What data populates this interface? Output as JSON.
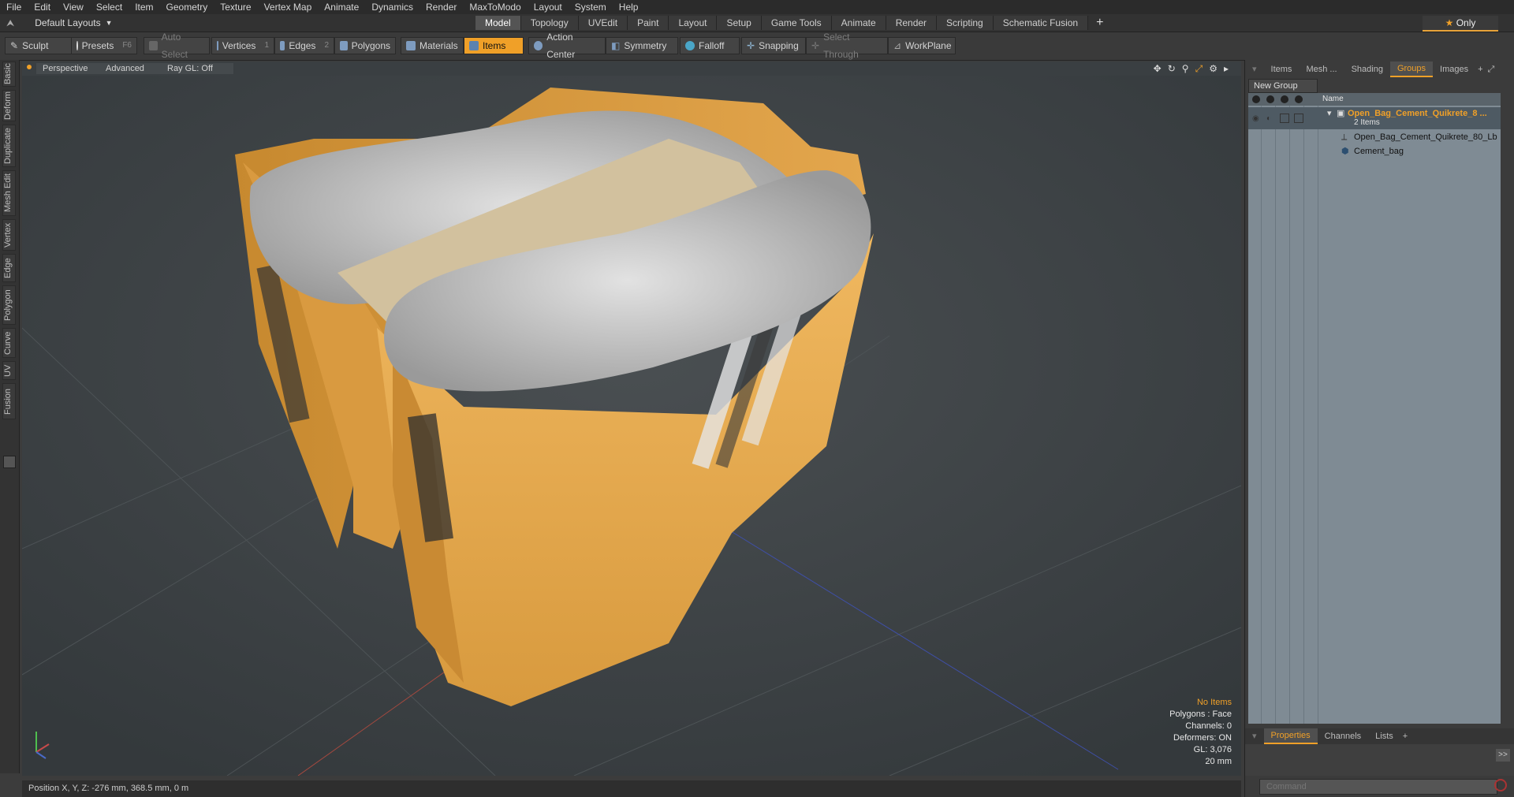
{
  "menu": [
    "File",
    "Edit",
    "View",
    "Select",
    "Item",
    "Geometry",
    "Texture",
    "Vertex Map",
    "Animate",
    "Dynamics",
    "Render",
    "MaxToModo",
    "Layout",
    "System",
    "Help"
  ],
  "layout": {
    "dropdown": "Default Layouts",
    "tabs": [
      "Model",
      "Topology",
      "UVEdit",
      "Paint",
      "Layout",
      "Setup",
      "Game Tools",
      "Animate",
      "Render",
      "Scripting",
      "Schematic Fusion"
    ],
    "active_tab": "Model",
    "only_label": "Only"
  },
  "toolbar": {
    "sculpt": "Sculpt",
    "presets": "Presets",
    "presets_key": "F6",
    "auto_select": "Auto Select",
    "vertices": "Vertices",
    "vertices_key": "1",
    "edges": "Edges",
    "edges_key": "2",
    "polygons": "Polygons",
    "materials": "Materials",
    "items": "Items",
    "action_center": "Action Center",
    "symmetry": "Symmetry",
    "falloff": "Falloff",
    "snapping": "Snapping",
    "select_through": "Select Through",
    "workplane": "WorkPlane"
  },
  "left_tabs": [
    "Basic",
    "Deform",
    "Duplicate",
    "Mesh Edit",
    "Vertex",
    "Edge",
    "Polygon",
    "Curve",
    "UV",
    "Fusion"
  ],
  "viewport": {
    "view": "Perspective",
    "shading": "Advanced",
    "raygl": "Ray GL: Off",
    "stats": {
      "items": "No Items",
      "polygons": "Polygons : Face",
      "channels": "Channels: 0",
      "deformers": "Deformers: ON",
      "gl": "GL: 3,076",
      "scale": "20 mm"
    }
  },
  "status": {
    "position": "Position X, Y, Z:   -276 mm, 368.5 mm, 0 m"
  },
  "right_panel": {
    "tabs": [
      "Items",
      "Mesh ...",
      "Shading",
      "Groups",
      "Images"
    ],
    "active_tab": "Groups",
    "new_group": "New Group",
    "column_name": "Name",
    "group": {
      "name": "Open_Bag_Cement_Quikrete_8 ...",
      "count": "2 Items",
      "children": [
        "Open_Bag_Cement_Quikrete_80_Lb",
        "Cement_bag"
      ]
    },
    "bottom_tabs": [
      "Properties",
      "Channels",
      "Lists"
    ],
    "bottom_active": "Properties",
    "command_placeholder": "Command",
    "expand": ">>"
  },
  "colors": {
    "accent": "#f0a028",
    "bag": "#e8a94a",
    "cement": "#c9c9c9"
  }
}
